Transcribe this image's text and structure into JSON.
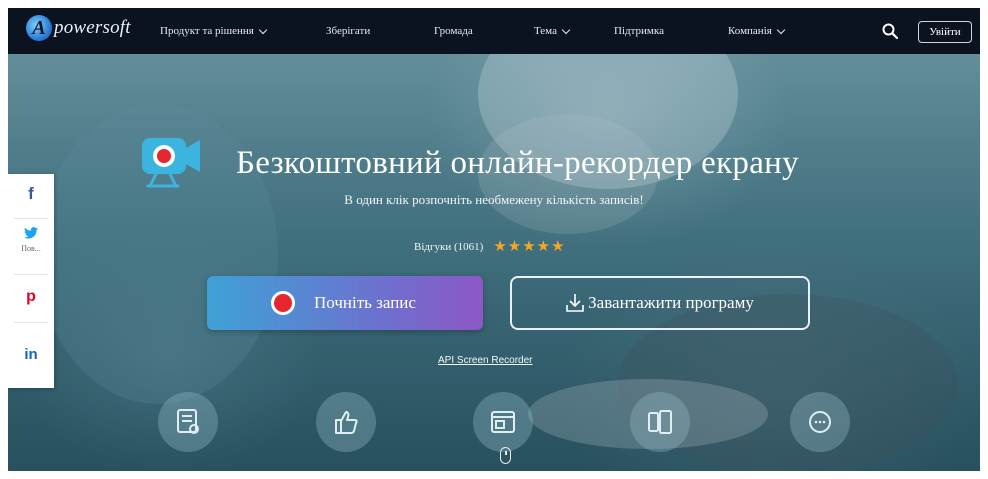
{
  "header": {
    "logo_letter": "A",
    "logo_text": "powersoft",
    "nav": [
      {
        "label": "Продукт та рішення",
        "dropdown": true
      },
      {
        "label": "Зберігати",
        "dropdown": false
      },
      {
        "label": "Громада",
        "dropdown": false
      },
      {
        "label": "Тема",
        "dropdown": true
      },
      {
        "label": "Підтримка",
        "dropdown": false
      },
      {
        "label": "Компанія",
        "dropdown": true
      }
    ],
    "search_icon": "search-icon",
    "login_label": "Увійти"
  },
  "social": {
    "facebook": "f",
    "twitter_caption": "Пов...",
    "pinterest": "p",
    "linkedin": "in"
  },
  "hero": {
    "title": "Безкоштовний онлайн-рекордер екрану",
    "subtitle": "В один клік розпочніть необмежену кількість записів!",
    "reviews_label": "Відгуки (1061)",
    "stars": "★★★★★",
    "rating": 5,
    "start_label": "Почніть запис",
    "download_label": "Завантажити програму",
    "api_link": "API Screen Recorder"
  },
  "features": [
    "list-icon",
    "thumbs-up-icon",
    "video-window-icon",
    "devices-icon",
    "chat-bubble-icon"
  ],
  "colors": {
    "header_bg": "#0b1220",
    "accent_blue": "#3ea2d6",
    "accent_purple": "#8d57c6",
    "record_red": "#e8262f",
    "star": "#f5a623"
  }
}
